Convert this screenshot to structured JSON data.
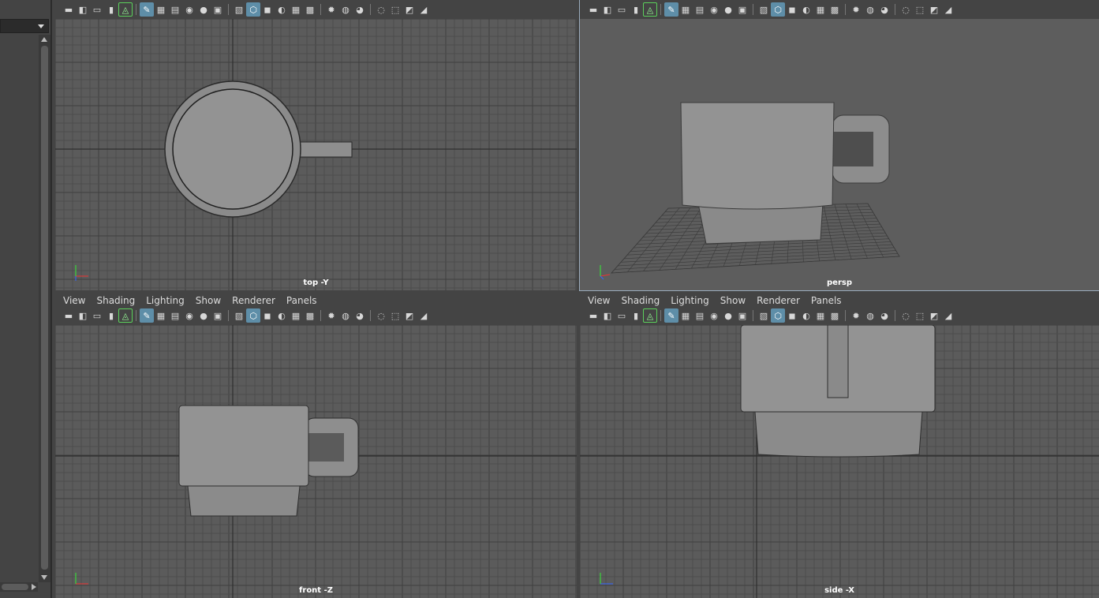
{
  "left_panel": {
    "scroll": "vertical"
  },
  "menu": [
    "View",
    "Shading",
    "Lighting",
    "Show",
    "Renderer",
    "Panels"
  ],
  "viewports": [
    {
      "id": "top",
      "label": "top -Y",
      "has_menu": false
    },
    {
      "id": "persp",
      "label": "persp",
      "has_menu": false
    },
    {
      "id": "front",
      "label": "front -Z",
      "has_menu": true
    },
    {
      "id": "side",
      "label": "side -X",
      "has_menu": true
    }
  ],
  "toolbar_icons": [
    "camera-icon",
    "camera-attributes-icon",
    "bookmark-icon",
    "image-plane-icon",
    "film-gate-icon",
    "grid-icon",
    "resolution-gate-icon",
    "gate-mask-icon",
    "field-chart-icon",
    "safe-action-icon",
    "safe-title-icon",
    "wireframe-icon",
    "smooth-shade-icon",
    "default-material-icon",
    "textured-icon",
    "xray-icon",
    "lights-icon",
    "shadows-icon",
    "ambient-occlusion-icon",
    "motion-blur-icon",
    "isolate-select-icon",
    "xray-joints-icon",
    "pan-zoom-icon",
    "hud-icon"
  ],
  "colors": {
    "bg": "#444444",
    "viewport_bg": "#5b5b5b",
    "grid_minor": "#4a4a4a",
    "grid_major": "#3d3d3d",
    "highlight": "#5e8ea8"
  }
}
